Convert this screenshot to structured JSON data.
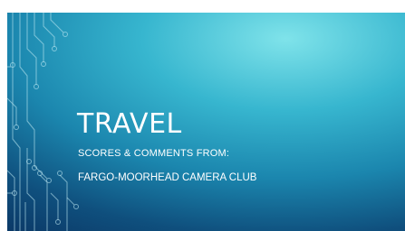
{
  "slide": {
    "title": "TRAVEL",
    "subtitle_line1": "SCORES & COMMENTS FROM:",
    "subtitle_line2": "FARGO-MOORHEAD CAMERA CLUB",
    "colors": {
      "background_light": "#7fe3ea",
      "background_mid": "#1b86ae",
      "background_dark": "#0b3866",
      "circuit_lines": "#bfe9f3",
      "text": "#ffffff"
    },
    "decoration": "circuit-board-lines"
  }
}
